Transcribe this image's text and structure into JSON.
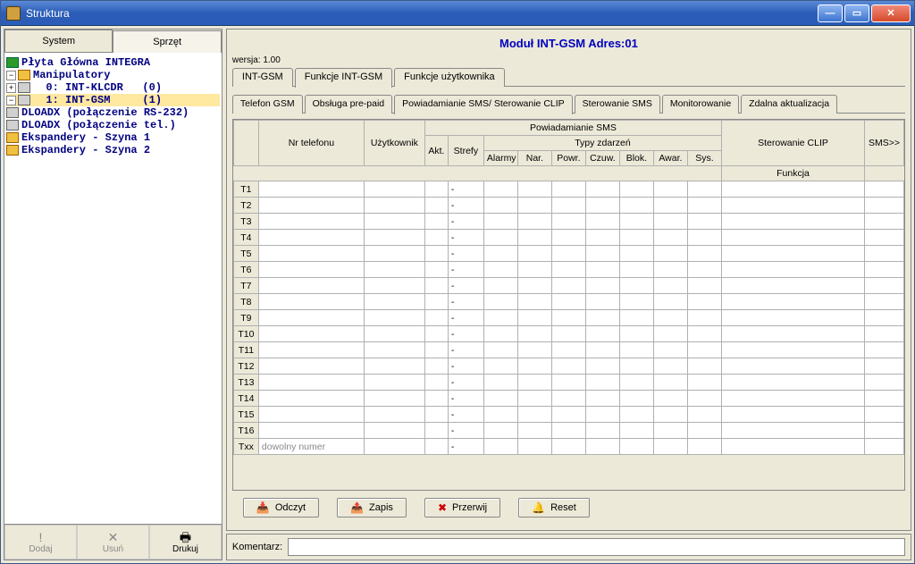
{
  "window": {
    "title": "Struktura"
  },
  "leftTabs": {
    "system": "System",
    "sprzet": "Sprzęt"
  },
  "tree": {
    "root": "Płyta Główna INTEGRA",
    "manip": "Manipulatory",
    "dev0": "  0: INT-KLCDR   (0)",
    "dev1": "  1: INT-GSM     (1)",
    "dloadx1": "DLOADX (połączenie RS-232)",
    "dloadx2": "DLOADX (połączenie tel.)",
    "exp1": "Ekspandery - Szyna 1",
    "exp2": "Ekspandery - Szyna 2"
  },
  "leftToolbar": {
    "dodaj": "Dodaj",
    "usun": "Usuń",
    "drukuj": "Drukuj"
  },
  "module": {
    "title": "Moduł INT-GSM Adres:01",
    "version": "wersja: 1.00"
  },
  "mainTabs": {
    "intgsm": "INT-GSM",
    "funkcje": "Funkcje INT-GSM",
    "uzytk": "Funkcje użytkownika"
  },
  "subTabs": {
    "telefon": "Telefon GSM",
    "prepaid": "Obsługa pre-paid",
    "powiadom": "Powiadamianie SMS/ Sterowanie CLIP",
    "stersms": "Sterowanie SMS",
    "monitor": "Monitorowanie",
    "zdalna": "Zdalna aktualizacja"
  },
  "grid": {
    "groupPowiadom": "Powiadamianie SMS",
    "groupTypy": "Typy zdarzeń",
    "groupSter": "Sterowanie CLIP",
    "col": {
      "nr": "Nr telefonu",
      "uzytk": "Użytkownik",
      "akt": "Akt.",
      "strefy": "Strefy",
      "alarmy": "Alarmy",
      "nar": "Nar.",
      "powr": "Powr.",
      "czuw": "Czuw.",
      "blok": "Blok.",
      "awar": "Awar.",
      "sys": "Sys.",
      "funkcja": "Funkcja",
      "sms": "SMS>>"
    },
    "rowLabels": [
      "T1",
      "T2",
      "T3",
      "T4",
      "T5",
      "T6",
      "T7",
      "T8",
      "T9",
      "T10",
      "T11",
      "T12",
      "T13",
      "T14",
      "T15",
      "T16",
      "Txx"
    ],
    "placeholder": "dowolny numer",
    "dash": "-"
  },
  "buttons": {
    "odczyt": "Odczyt",
    "zapis": "Zapis",
    "przerwij": "Przerwij",
    "reset": "Reset"
  },
  "comment": {
    "label": "Komentarz:",
    "value": ""
  }
}
